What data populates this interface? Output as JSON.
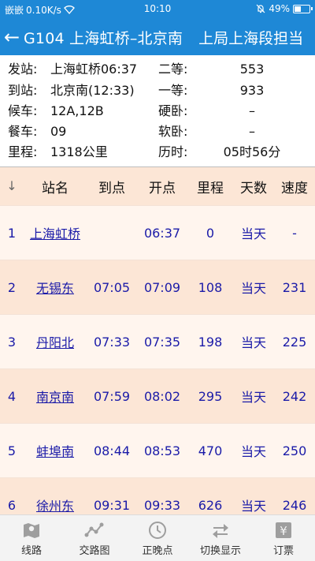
{
  "status_bar": {
    "carrier": "嵌嵌",
    "speed": "0.10K/s",
    "time": "10:10",
    "battery": "49%",
    "battery_level": 0.49
  },
  "title_bar": {
    "title": "G104 上海虹桥–北京南",
    "subtitle": "上局上海段担当"
  },
  "info": {
    "dep_label": "发站:",
    "dep_value": "上海虹桥06:37",
    "arr_label": "到站:",
    "arr_value": "北京南(12:33)",
    "wait_label": "候车:",
    "wait_value": "12A,12B",
    "dining_label": "餐车:",
    "dining_value": "09",
    "mileage_label": "里程:",
    "mileage_value": "1318公里",
    "second_label": "二等:",
    "second_value": "553",
    "first_label": "一等:",
    "first_value": "933",
    "hard_sleeper_label": "硬卧:",
    "hard_sleeper_value": "–",
    "soft_sleeper_label": "软卧:",
    "soft_sleeper_value": "–",
    "duration_label": "历时:",
    "duration_value": "05时56分"
  },
  "table": {
    "headers": {
      "no": "↓",
      "name": "站名",
      "arrive": "到点",
      "depart": "开点",
      "km": "里程",
      "days": "天数",
      "speed": "速度"
    },
    "rows": [
      {
        "no": "1",
        "name": "上海虹桥",
        "arrive": "",
        "depart": "06:37",
        "km": "0",
        "days": "当天",
        "speed": "-"
      },
      {
        "no": "2",
        "name": "无锡东",
        "arrive": "07:05",
        "depart": "07:09",
        "km": "108",
        "days": "当天",
        "speed": "231"
      },
      {
        "no": "3",
        "name": "丹阳北",
        "arrive": "07:33",
        "depart": "07:35",
        "km": "198",
        "days": "当天",
        "speed": "225"
      },
      {
        "no": "4",
        "name": "南京南",
        "arrive": "07:59",
        "depart": "08:02",
        "km": "295",
        "days": "当天",
        "speed": "242"
      },
      {
        "no": "5",
        "name": "蚌埠南",
        "arrive": "08:44",
        "depart": "08:53",
        "km": "470",
        "days": "当天",
        "speed": "250"
      },
      {
        "no": "6",
        "name": "徐州东",
        "arrive": "09:31",
        "depart": "09:33",
        "km": "626",
        "days": "当天",
        "speed": "246"
      }
    ]
  },
  "bottom_nav": {
    "route": "线路",
    "route_map": "交路图",
    "on_time": "正晚点",
    "switch_display": "切换显示",
    "booking": "订票"
  }
}
